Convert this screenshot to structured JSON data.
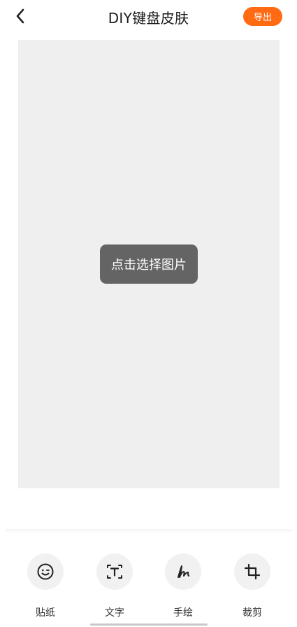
{
  "header": {
    "back_icon": "chevron-left-icon",
    "title": "DIY键盘皮肤",
    "export_label": "导出"
  },
  "canvas": {
    "pick_label": "点击选择图片"
  },
  "toolbar": {
    "items": [
      {
        "icon": "smiley-sticker-icon",
        "label": "贴纸"
      },
      {
        "icon": "text-frame-icon",
        "label": "文字"
      },
      {
        "icon": "handwriting-icon",
        "label": "手绘"
      },
      {
        "icon": "crop-icon",
        "label": "裁剪"
      }
    ]
  },
  "colors": {
    "accent": "#ff6a13",
    "canvas_bg": "#efefef",
    "button_bg": "#646464"
  }
}
